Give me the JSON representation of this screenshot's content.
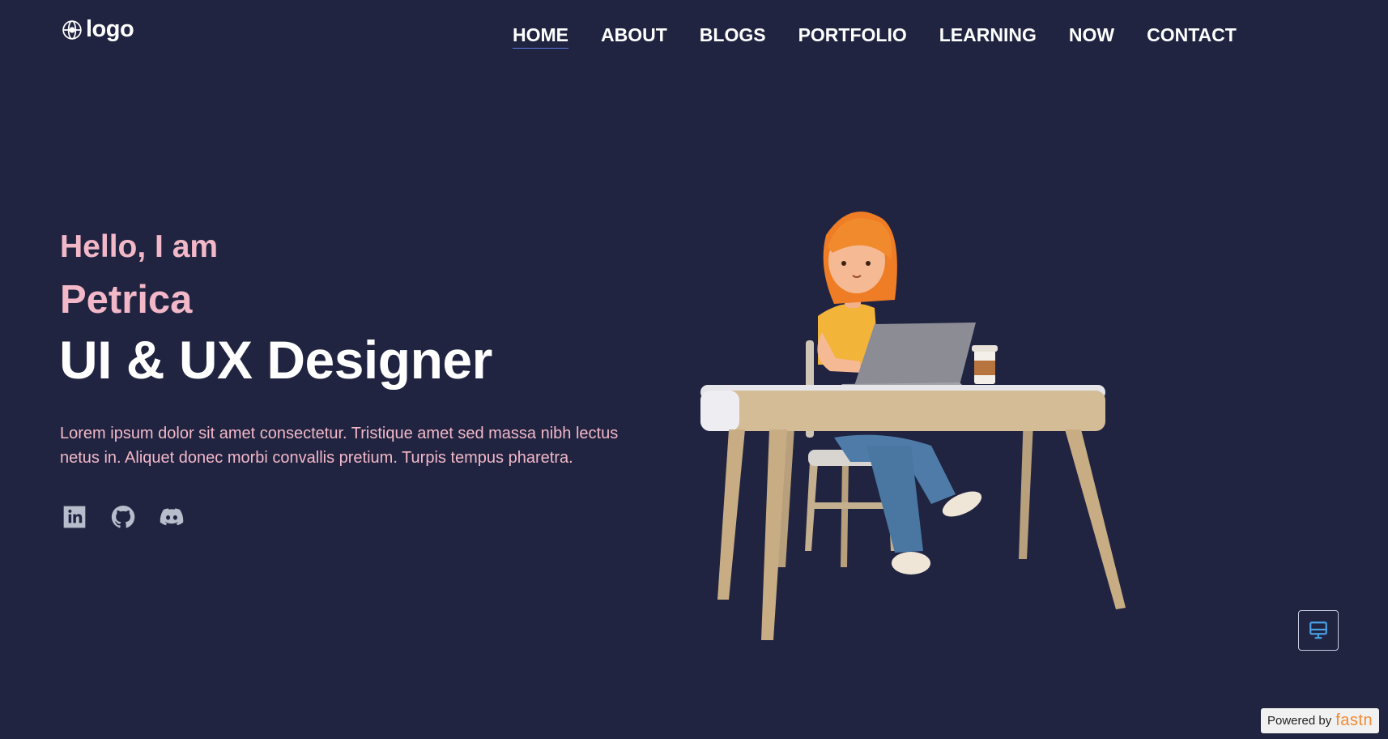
{
  "header": {
    "logo_text": "logo",
    "nav": [
      {
        "label": "HOME",
        "active": true
      },
      {
        "label": "ABOUT"
      },
      {
        "label": "BLOGS"
      },
      {
        "label": "PORTFOLIO"
      },
      {
        "label": "LEARNING"
      },
      {
        "label": "NOW"
      },
      {
        "label": "CONTACT"
      }
    ]
  },
  "hero": {
    "greeting": "Hello, I am",
    "name": "Petrica",
    "role": "UI & UX Designer",
    "bio": "Lorem ipsum dolor sit amet consectetur. Tristique amet sed massa nibh lectus netus in. Aliquet donec morbi convallis pretium. Turpis tempus pharetra."
  },
  "socials": [
    {
      "icon": "linkedin-icon"
    },
    {
      "icon": "github-icon"
    },
    {
      "icon": "discord-icon"
    }
  ],
  "footer": {
    "powered_prefix": "Powered by",
    "powered_brand": "fastn"
  },
  "colors": {
    "background": "#202441",
    "accent_pink": "#f3b8c8",
    "nav_underline": "#5b7be0",
    "brand_orange": "#ef8a33"
  }
}
